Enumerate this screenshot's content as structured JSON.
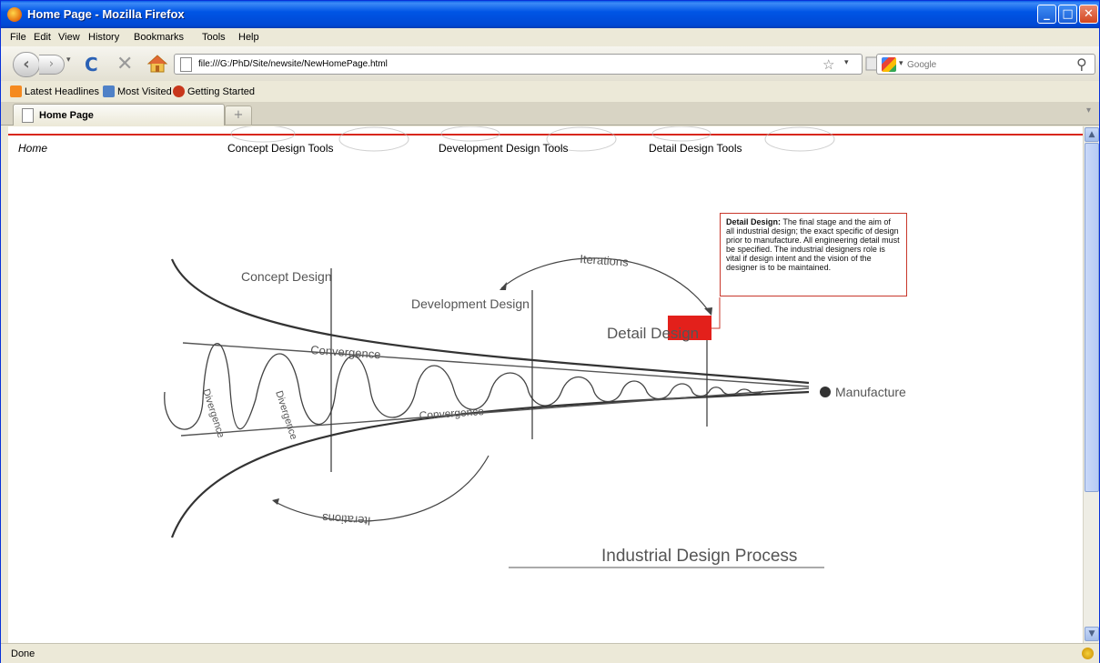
{
  "window": {
    "title": "Home Page - Mozilla Firefox"
  },
  "menu": [
    "File",
    "Edit",
    "View",
    "History",
    "Bookmarks",
    "Tools",
    "Help"
  ],
  "address_bar": {
    "url": "file:///G:/PhD/Site/newsite/NewHomePage.html"
  },
  "search_bar": {
    "placeholder": "Google"
  },
  "bookmarks": [
    "Latest Headlines",
    "Most Visited",
    "Getting Started"
  ],
  "tabs": [
    {
      "label": "Home Page"
    }
  ],
  "page": {
    "nav": {
      "home": "Home",
      "concept": "Concept Design Tools",
      "development": "Development Design Tools",
      "detail": "Detail Design Tools"
    },
    "diagram": {
      "concept_label": "Concept Design",
      "development_label": "Development Design",
      "detail_label": "Detail Design",
      "iterations_top": "Iterations",
      "iterations_bottom": "Iterations",
      "convergence_top": "Convergence",
      "convergence_bottom": "Convergence",
      "divergence_1": "Divergence",
      "divergence_2": "Divergence",
      "manufacture": "Manufacture",
      "title": "Industrial Design Process"
    },
    "popup": {
      "heading": "Detail Design:",
      "text": "The final stage and the aim of all industrial design; the exact specific of design prior to manufacture. All engineering detail must be specified.  The industrial designers role is vital if design intent and  the vision of the designer is to be maintained."
    }
  },
  "status": {
    "text": "Done"
  },
  "colors": {
    "accent_red": "#d8261b",
    "xp_blue": "#0055e5"
  }
}
